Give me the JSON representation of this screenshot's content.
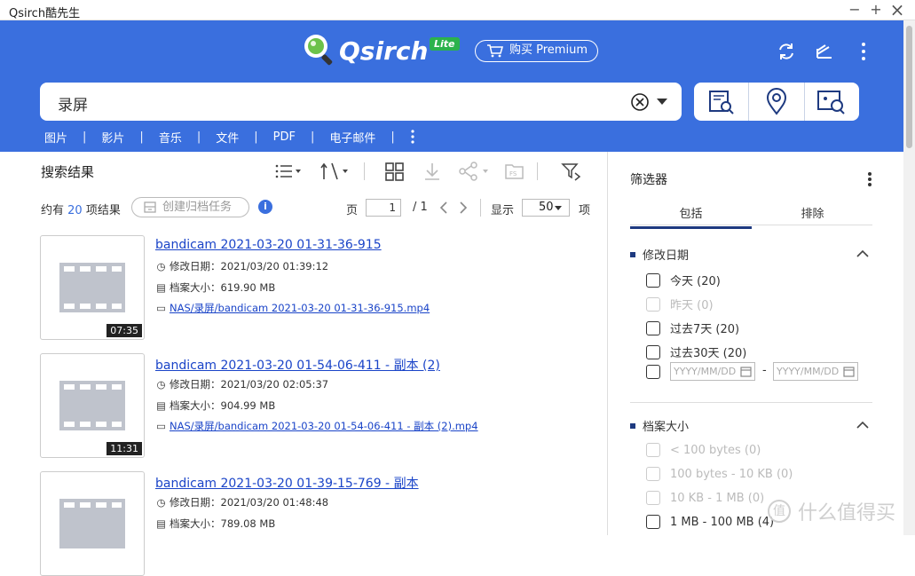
{
  "window": {
    "title": "Qsirch酷先生",
    "minimize": "−",
    "maximize": "+",
    "close": "×"
  },
  "header": {
    "logo_text": "Qsirch",
    "logo_badge": "Lite",
    "premium_label": "购买 Premium",
    "search_query": "录屏",
    "categories": [
      "图片",
      "影片",
      "音乐",
      "文件",
      "PDF",
      "电子邮件"
    ],
    "separator": "|"
  },
  "results": {
    "title": "搜索结果",
    "summary_prefix": "约有",
    "summary_count": "20",
    "summary_suffix": "项结果",
    "archive_label": "创建归档任务",
    "info": "i",
    "page_label": "页",
    "page_current": "1",
    "page_total": "/ 1",
    "show_label": "显示",
    "per_page": "50",
    "items_label": "项",
    "items": [
      {
        "title": "bandicam 2021-03-20 01-31-36-915",
        "modified_label": "修改日期：",
        "modified": "2021/03/20 01:39:12",
        "size_label": "档案大小：",
        "size": "619.90 MB",
        "path": "NAS/录屏/bandicam 2021-03-20 01-31-36-915.mp4",
        "duration": "07:35"
      },
      {
        "title": "bandicam 2021-03-20 01-54-06-411 - 副本 (2)",
        "modified_label": "修改日期：",
        "modified": "2021/03/20 02:05:37",
        "size_label": "档案大小：",
        "size": "904.99 MB",
        "path": "NAS/录屏/bandicam 2021-03-20 01-54-06-411 - 副本 (2).mp4",
        "duration": "11:31"
      },
      {
        "title": "bandicam 2021-03-20 01-39-15-769 - 副本",
        "modified_label": "修改日期：",
        "modified": "2021/03/20 01:48:48",
        "size_label": "档案大小：",
        "size": "789.08 MB",
        "path": "",
        "duration": ""
      }
    ]
  },
  "filter": {
    "title": "筛选器",
    "tab_include": "包括",
    "tab_exclude": "排除",
    "date_section": "修改日期",
    "date_options": [
      "今天 (20)",
      "昨天 (0)",
      "过去7天 (20)",
      "过去30天 (20)"
    ],
    "date_placeholder": "YYYY/MM/DD",
    "date_dash": "-",
    "size_section": "档案大小",
    "size_options": [
      "< 100 bytes (0)",
      "100 bytes - 10 KB (0)",
      "10 KB - 1 MB (0)",
      "1 MB - 100 MB (4)"
    ]
  },
  "watermark": {
    "icon": "值",
    "text": "什么值得买"
  },
  "colors": {
    "header_blue": "#3a6fde",
    "link_blue": "#1a44c8",
    "accent_navy": "#1e3a80",
    "badge_green": "#2bb24c"
  }
}
